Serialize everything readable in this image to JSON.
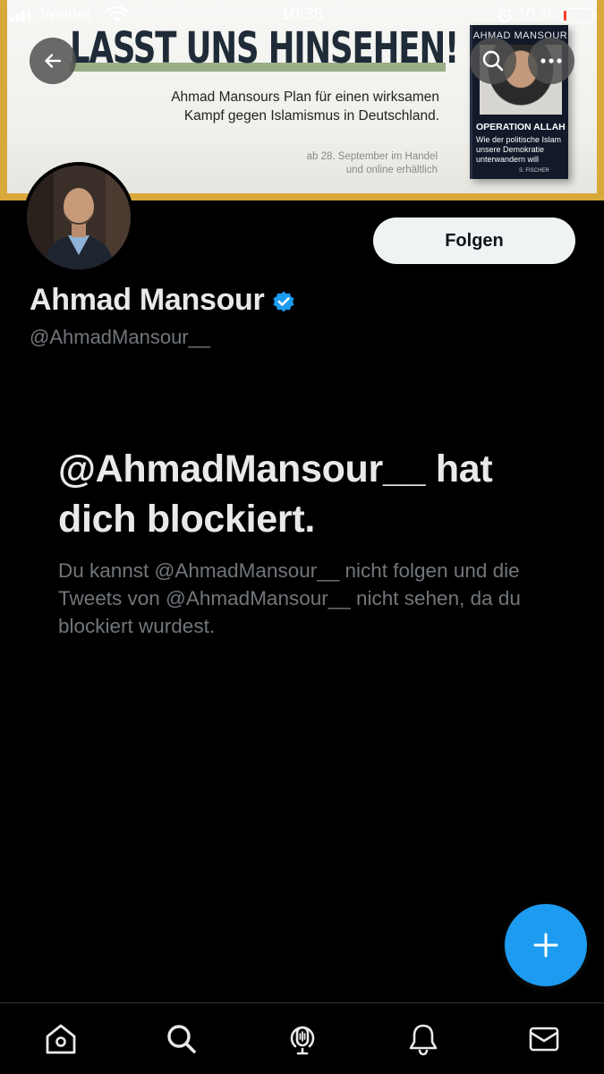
{
  "status_bar": {
    "carrier": "freenet",
    "time": "10:35",
    "battery_percent": "10 %",
    "battery_level": 0.1,
    "battery_color": "#ff3b30"
  },
  "banner": {
    "headline": "LASST UNS HINSEHEN!",
    "subtitle_line1": "Ahmad Mansours Plan für einen wirksamen",
    "subtitle_line2": "Kampf gegen Islamismus in Deutschland.",
    "release_line1": "ab 28. September im Handel",
    "release_line2": "und online erhältlich",
    "book": {
      "author": "AHMAD MANSOUR",
      "title": "OPERATION ALLAH",
      "subtitle_lines": [
        "Wie der politische Islam",
        "unsere Demokratie",
        "unterwandern will"
      ],
      "publisher": "S. FISCHER"
    },
    "frame_color": "#d9a83a"
  },
  "overlay_buttons": {
    "back_icon": "arrow-left-icon",
    "search_icon": "search-icon",
    "more_icon": "more-horizontal-icon"
  },
  "profile": {
    "display_name": "Ahmad Mansour",
    "handle": "@AhmadMansour__",
    "verified": true,
    "verified_color": "#1d9bf0",
    "follow_label": "Folgen"
  },
  "blocked": {
    "title": "@AhmadMansour__ hat dich blockiert.",
    "description": "Du kannst @AhmadMansour__ nicht folgen und die Tweets von @AhmadMansour__ nicht sehen, da du blockiert wurdest."
  },
  "fab": {
    "icon": "plus-icon",
    "color": "#1d9bf0"
  },
  "tabbar": {
    "items": [
      {
        "name": "home",
        "icon": "home-icon"
      },
      {
        "name": "search",
        "icon": "search-icon"
      },
      {
        "name": "spaces",
        "icon": "spaces-microphone-icon"
      },
      {
        "name": "notifications",
        "icon": "bell-icon"
      },
      {
        "name": "messages",
        "icon": "mail-icon"
      }
    ]
  }
}
